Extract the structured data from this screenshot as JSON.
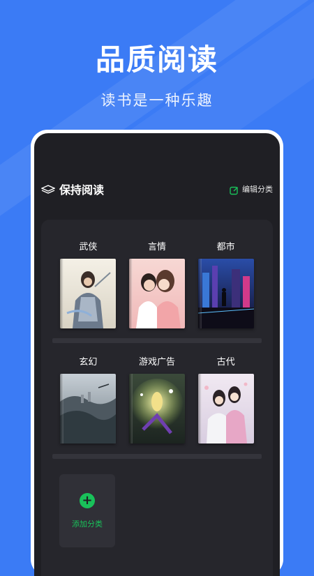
{
  "hero": {
    "title": "品质阅读",
    "subtitle": "读书是一种乐趣"
  },
  "header": {
    "title": "保持阅读",
    "edit_label": "编辑分类"
  },
  "categories": [
    {
      "label": "武侠",
      "cover_icon": "wuxia-hero-cover"
    },
    {
      "label": "言情",
      "cover_icon": "romance-couple-cover"
    },
    {
      "label": "都市",
      "cover_icon": "city-night-cover"
    },
    {
      "label": "玄幻",
      "cover_icon": "fantasy-castle-cover"
    },
    {
      "label": "游戏广告",
      "cover_icon": "game-magic-cover"
    },
    {
      "label": "古代",
      "cover_icon": "ancient-couple-cover"
    }
  ],
  "add_category": {
    "label": "添加分类",
    "icon": "plus-icon"
  },
  "colors": {
    "background": "#3b7bf5",
    "screen": "#1f1f24",
    "accent": "#19c15a"
  }
}
